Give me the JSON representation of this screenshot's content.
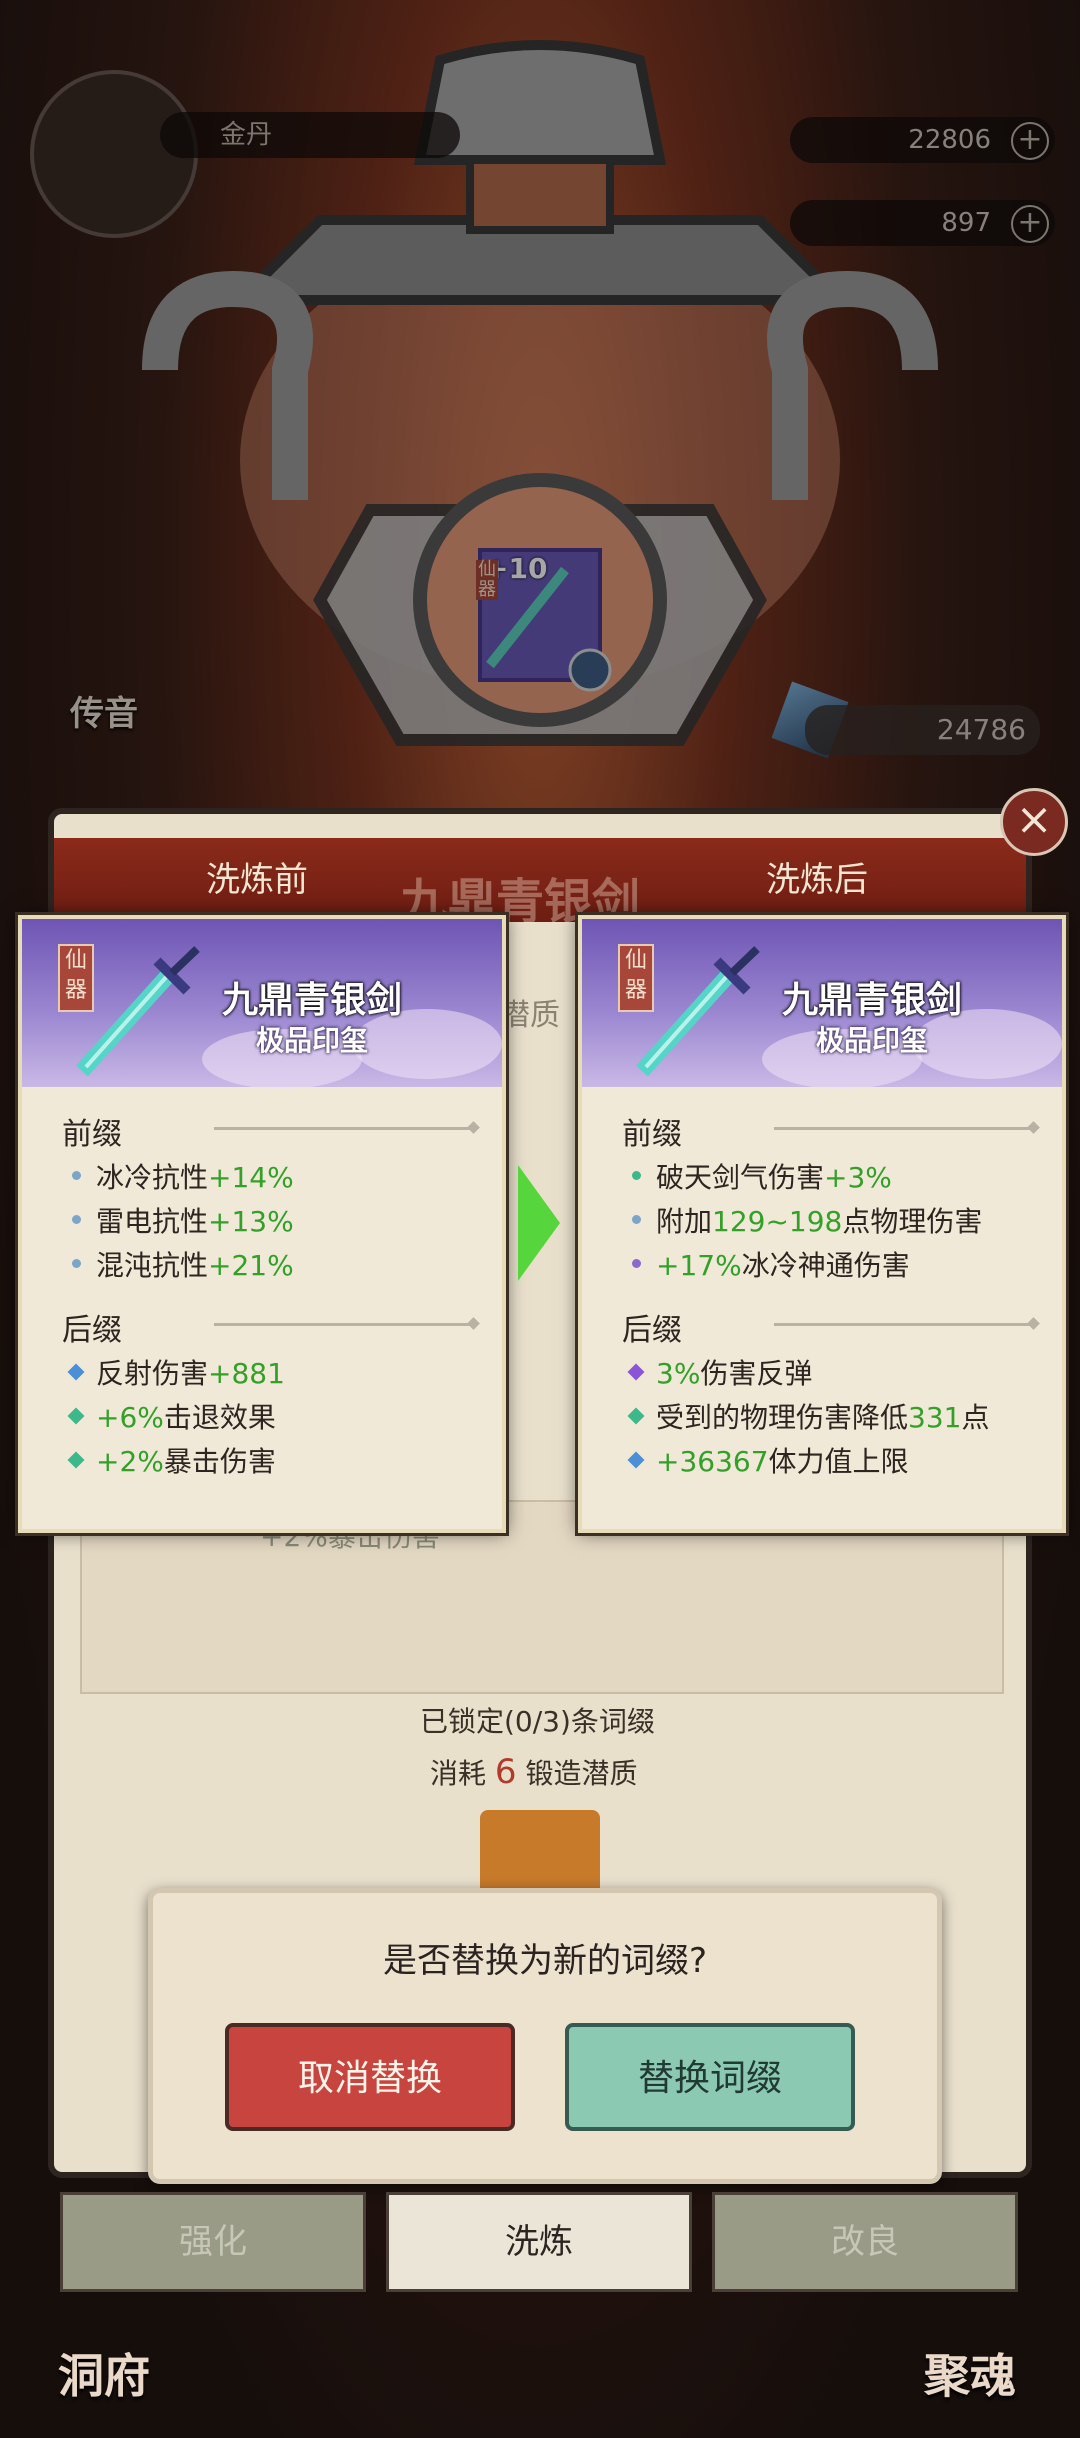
{
  "background": {
    "player_name": "金丹",
    "resource_top": "22806",
    "resource_mid": "897",
    "crystal_count": "24786",
    "equip_level": "+10",
    "equip_tag": "仙器",
    "side_label_left": "传音",
    "bottom_left": "洞府",
    "bottom_right": "聚魂"
  },
  "panel": {
    "ghost_title": "九鼎青银剑",
    "ghost_sub": "潜质",
    "header_before": "洗炼前",
    "header_after": "洗炼后",
    "locked_text": "已锁定(0/3)条词缀",
    "cost_prefix": "消耗",
    "cost_value": "6",
    "cost_suffix": "锻造潜质",
    "ghost_row": "+2%暴击伤害"
  },
  "cards": {
    "before": {
      "tag": "仙器",
      "name": "九鼎青银剑",
      "sub": "极品印玺",
      "prefix_title": "前缀",
      "suffix_title": "后缀",
      "prefix_rows": [
        {
          "text": "冰冷抗性",
          "val": "+14%"
        },
        {
          "text": "雷电抗性",
          "val": "+13%"
        },
        {
          "text": "混沌抗性",
          "val": "+21%"
        }
      ],
      "suffix_rows": [
        {
          "a": "反射伤害",
          "b": "+881",
          "c": ""
        },
        {
          "a": "",
          "b": "+6%",
          "c": "击退效果"
        },
        {
          "a": "",
          "b": "+2%",
          "c": "暴击伤害"
        }
      ]
    },
    "after": {
      "tag": "仙器",
      "name": "九鼎青银剑",
      "sub": "极品印玺",
      "prefix_title": "前缀",
      "suffix_title": "后缀",
      "prefix_rows": [
        {
          "a": "破天剑气伤害",
          "b": "+3%",
          "c": ""
        },
        {
          "a": "附加",
          "b": "129~198",
          "c": "点物理伤害"
        },
        {
          "a": "",
          "b": "+17%",
          "c": "冰冷神通伤害"
        }
      ],
      "suffix_rows": [
        {
          "a": "",
          "b": "3%",
          "c": "伤害反弹"
        },
        {
          "a": "受到的物理伤害降低",
          "b": "331",
          "c": "点"
        },
        {
          "a": "",
          "b": "+36367",
          "c": "体力值上限"
        }
      ]
    }
  },
  "dialog": {
    "question": "是否替换为新的词缀?",
    "cancel_label": "取消替换",
    "confirm_label": "替换词缀"
  },
  "tabs": {
    "strengthen": "强化",
    "refine": "洗炼",
    "improve": "改良"
  },
  "colors": {
    "header_red": "#7a2416",
    "green_value": "#33a028",
    "cancel_red": "#c8443e",
    "confirm_teal": "#8cc9b2",
    "card_purple": "#9a86d0"
  }
}
